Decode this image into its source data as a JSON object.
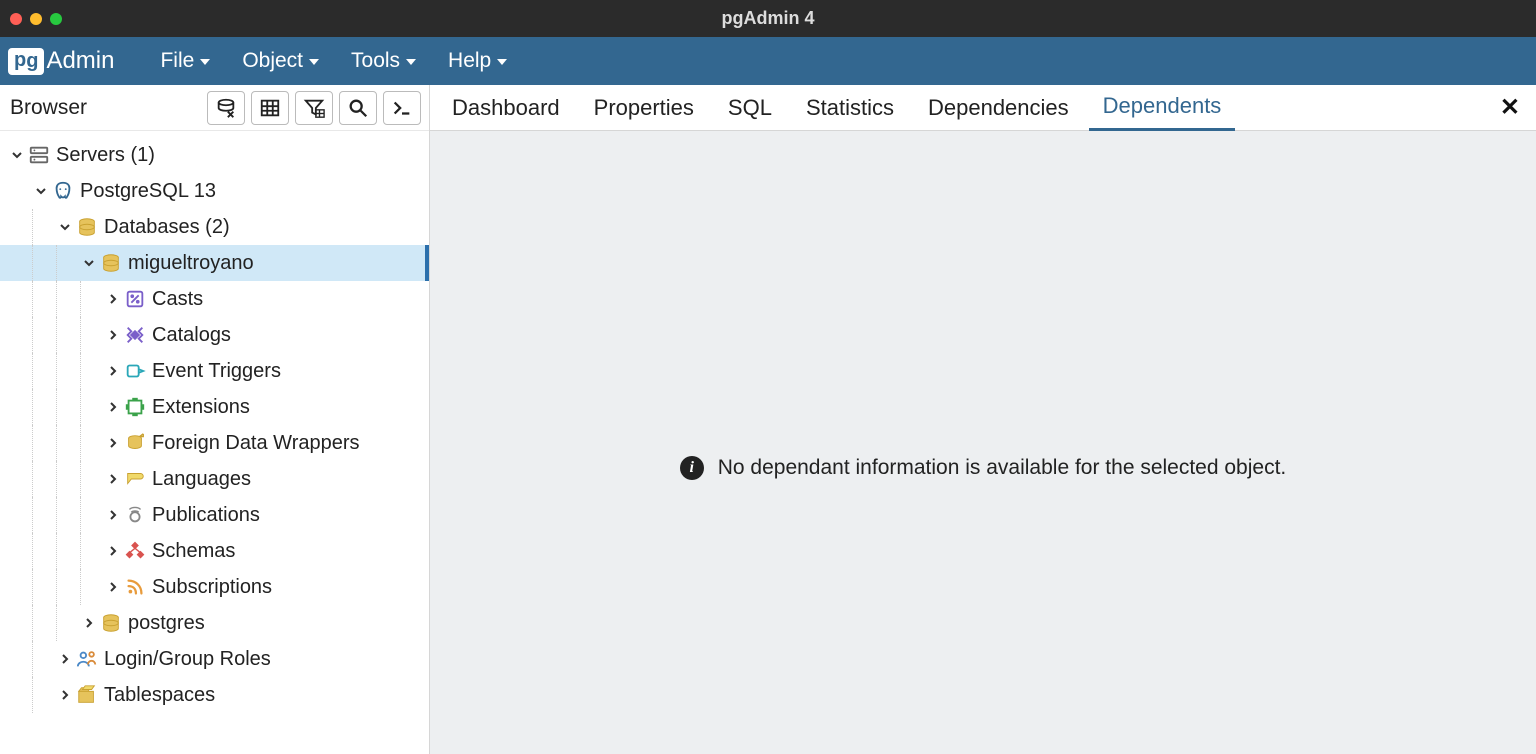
{
  "window": {
    "title": "pgAdmin 4"
  },
  "logo": {
    "badge": "pg",
    "text": "Admin"
  },
  "menubar": [
    {
      "label": "File"
    },
    {
      "label": "Object"
    },
    {
      "label": "Tools"
    },
    {
      "label": "Help"
    }
  ],
  "sidebar": {
    "title": "Browser",
    "toolbar_icons": [
      "query-tool",
      "view-data",
      "filtered-rows",
      "search",
      "psql"
    ]
  },
  "tree": [
    {
      "indent": 0,
      "expanded": true,
      "icon": "servers",
      "label": "Servers (1)"
    },
    {
      "indent": 1,
      "expanded": true,
      "icon": "postgres",
      "label": "PostgreSQL 13"
    },
    {
      "indent": 2,
      "expanded": true,
      "icon": "databases",
      "label": "Databases (2)"
    },
    {
      "indent": 3,
      "expanded": true,
      "icon": "database",
      "label": "migueltroyano",
      "selected": true
    },
    {
      "indent": 4,
      "expanded": false,
      "icon": "casts",
      "label": "Casts"
    },
    {
      "indent": 4,
      "expanded": false,
      "icon": "catalogs",
      "label": "Catalogs"
    },
    {
      "indent": 4,
      "expanded": false,
      "icon": "event-triggers",
      "label": "Event Triggers"
    },
    {
      "indent": 4,
      "expanded": false,
      "icon": "extensions",
      "label": "Extensions"
    },
    {
      "indent": 4,
      "expanded": false,
      "icon": "fdw",
      "label": "Foreign Data Wrappers"
    },
    {
      "indent": 4,
      "expanded": false,
      "icon": "languages",
      "label": "Languages"
    },
    {
      "indent": 4,
      "expanded": false,
      "icon": "publications",
      "label": "Publications"
    },
    {
      "indent": 4,
      "expanded": false,
      "icon": "schemas",
      "label": "Schemas"
    },
    {
      "indent": 4,
      "expanded": false,
      "icon": "subscriptions",
      "label": "Subscriptions"
    },
    {
      "indent": 3,
      "expanded": false,
      "icon": "database",
      "label": "postgres"
    },
    {
      "indent": 2,
      "expanded": false,
      "icon": "roles",
      "label": "Login/Group Roles"
    },
    {
      "indent": 2,
      "expanded": false,
      "icon": "tablespaces",
      "label": "Tablespaces"
    }
  ],
  "tabs": [
    {
      "label": "Dashboard"
    },
    {
      "label": "Properties"
    },
    {
      "label": "SQL"
    },
    {
      "label": "Statistics"
    },
    {
      "label": "Dependencies"
    },
    {
      "label": "Dependents",
      "active": true
    }
  ],
  "content": {
    "info_message": "No dependant information is available for the selected object."
  }
}
